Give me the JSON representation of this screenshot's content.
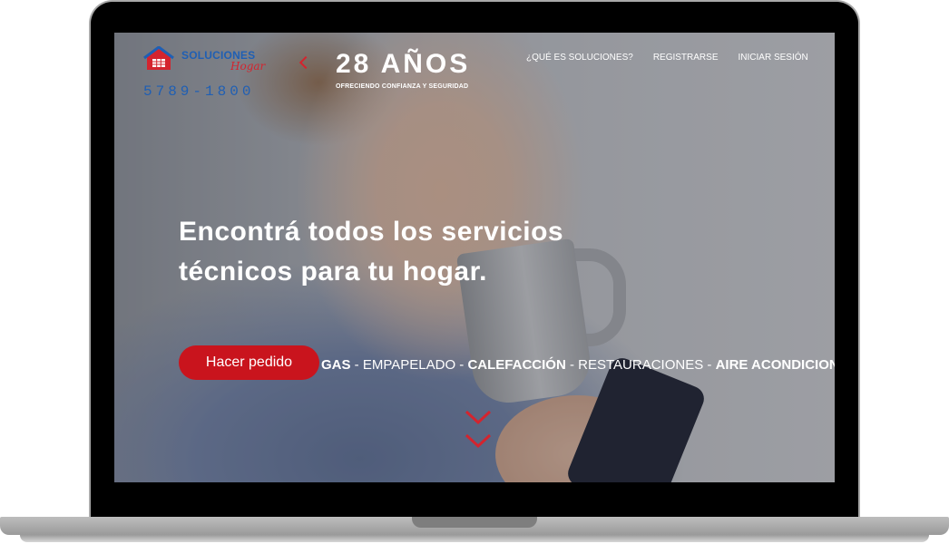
{
  "brand": {
    "title": "SOLUCIONES",
    "subtitle": "Hogar",
    "phone": "5789-1800"
  },
  "promo": {
    "years": "28 AÑOS",
    "tagline": "OFRECIENDO CONFIANZA Y SEGURIDAD"
  },
  "nav": {
    "items": [
      {
        "label": "¿QUÉ ES SOLUCIONES?"
      },
      {
        "label": "REGISTRARSE"
      },
      {
        "label": "INICIAR SESIÓN"
      }
    ]
  },
  "hero": {
    "headline": "Encontrá todos los servicios técnicos para tu hogar.",
    "cta_label": "Hacer pedido",
    "services": [
      {
        "label": "GAS",
        "bold": true
      },
      {
        "label": "EMPAPELADO",
        "bold": false
      },
      {
        "label": "CALEFACCIÓN",
        "bold": true
      },
      {
        "label": "RESTAURACIONES",
        "bold": false
      },
      {
        "label": "AIRE ACONDICIONADO",
        "bold": true
      }
    ]
  },
  "colors": {
    "accent": "#c9141d",
    "brand_blue": "#1f5fb4",
    "text": "#ffffff"
  },
  "icons": [
    "house-logo-icon",
    "chevron-left-icon",
    "scroll-down-icon"
  ]
}
